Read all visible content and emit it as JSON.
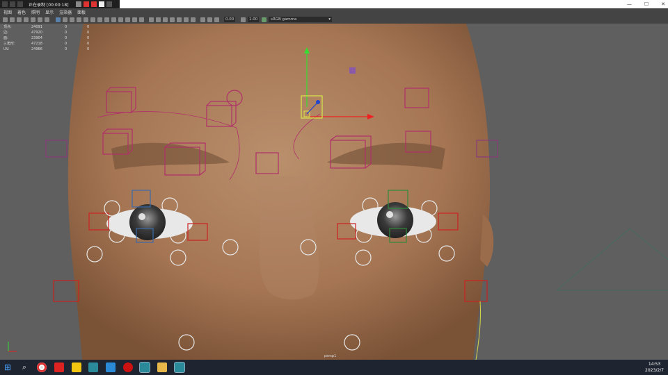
{
  "recorder": {
    "title": "正在录制 [00:00:18]"
  },
  "window_controls": {
    "minimize": "—",
    "maximize": "☐",
    "close": "✕"
  },
  "menu": [
    "视图",
    "着色",
    "照明",
    "显示",
    "渲染器",
    "面板"
  ],
  "toolbar": {
    "exposure": "0.00",
    "gamma": "1.00",
    "color_space": "sRGB gamma"
  },
  "hud": {
    "rows": [
      {
        "label": "顶点:",
        "total": "24091",
        "a": "0",
        "b": "0"
      },
      {
        "label": "边:",
        "total": "47920",
        "a": "0",
        "b": "0"
      },
      {
        "label": "面:",
        "total": "23904",
        "a": "0",
        "b": "0"
      },
      {
        "label": "三角形:",
        "total": "47218",
        "a": "0",
        "b": "0"
      },
      {
        "label": "UV:",
        "total": "24966",
        "a": "0",
        "b": "0"
      }
    ]
  },
  "camera_label": "persp1",
  "clock": {
    "time": "14:53",
    "date": "2023/2/7"
  },
  "colors": {
    "control_pink": "#b0306a",
    "control_red": "#cc2222",
    "control_green": "#2f8a3a",
    "move_y": "#33dd33",
    "move_x": "#ee2222"
  },
  "taskbar_icons": [
    "start-icon",
    "search-icon",
    "chrome-icon",
    "autodesk-icon",
    "sticky-notes-icon",
    "maya-icon",
    "qq-icon",
    "recorder-icon",
    "maya-icon",
    "file-explorer-icon",
    "maya-icon"
  ]
}
